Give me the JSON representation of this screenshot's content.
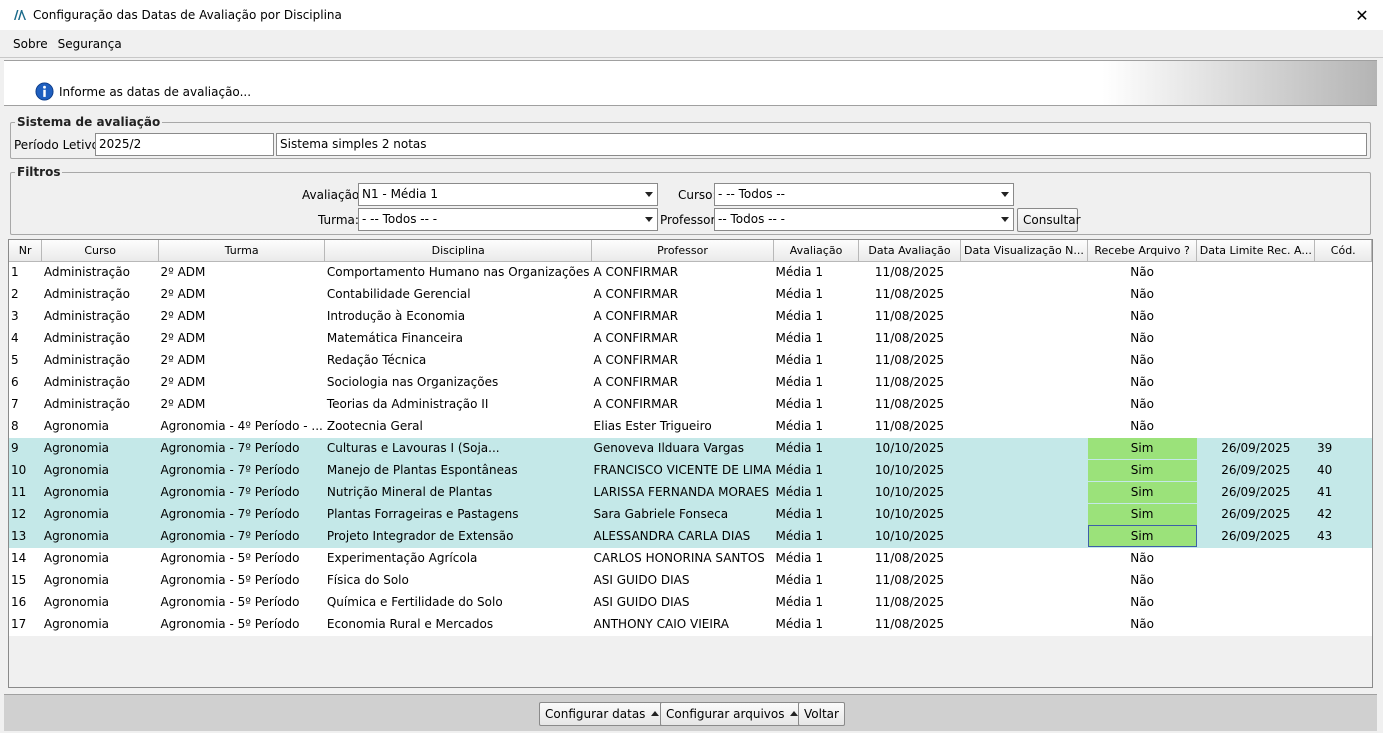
{
  "window": {
    "title": "Configuração das Datas de Avaliação por Disciplina",
    "close_label": "✕"
  },
  "menu": [
    {
      "label": "Sobre"
    },
    {
      "label": "Segurança"
    }
  ],
  "info": {
    "text": "Informe as datas de avaliação..."
  },
  "sistema": {
    "legend": "Sistema de avaliação",
    "periodo_label": "Período Letivo:",
    "periodo_value": "2025/2",
    "sistema_value": "Sistema simples 2 notas"
  },
  "filtros": {
    "legend": "Filtros",
    "avaliacao_label": "Avaliação:",
    "avaliacao_value": "N1 - Média 1",
    "curso_label": "Curso:",
    "curso_value": "- -- Todos --",
    "turma_label": "Turma:",
    "turma_value": "- -- Todos -- -",
    "professor_label": "Professor:",
    "professor_value": "-- Todos -- -",
    "consultar_label": "Consultar"
  },
  "table": {
    "headers": [
      "Nr",
      "Curso",
      "Turma",
      "Disciplina",
      "Professor",
      "Avaliação",
      "Data Avaliação",
      "Data Visualização N...",
      "Recebe Arquivo ?",
      "Data Limite Rec. A...",
      "Cód."
    ],
    "rows": [
      [
        "1",
        "Administração",
        "2º ADM",
        "Comportamento Humano nas Organizações",
        "A CONFIRMAR",
        "Média 1",
        "11/08/2025",
        "",
        "Não",
        "",
        ""
      ],
      [
        "2",
        "Administração",
        "2º ADM",
        "Contabilidade Gerencial",
        "A CONFIRMAR",
        "Média 1",
        "11/08/2025",
        "",
        "Não",
        "",
        ""
      ],
      [
        "3",
        "Administração",
        "2º ADM",
        "Introdução à Economia",
        "A CONFIRMAR",
        "Média 1",
        "11/08/2025",
        "",
        "Não",
        "",
        ""
      ],
      [
        "4",
        "Administração",
        "2º ADM",
        "Matemática Financeira",
        "A CONFIRMAR",
        "Média 1",
        "11/08/2025",
        "",
        "Não",
        "",
        ""
      ],
      [
        "5",
        "Administração",
        "2º ADM",
        "Redação Técnica",
        "A CONFIRMAR",
        "Média 1",
        "11/08/2025",
        "",
        "Não",
        "",
        ""
      ],
      [
        "6",
        "Administração",
        "2º ADM",
        "Sociologia nas Organizações",
        "A CONFIRMAR",
        "Média 1",
        "11/08/2025",
        "",
        "Não",
        "",
        ""
      ],
      [
        "7",
        "Administração",
        "2º ADM",
        "Teorias da Administração II",
        "A CONFIRMAR",
        "Média 1",
        "11/08/2025",
        "",
        "Não",
        "",
        ""
      ],
      [
        "8",
        "Agronomia",
        "Agronomia - 4º Período - ...",
        "Zootecnia Geral",
        "Elias Ester Trigueiro",
        "Média 1",
        "11/08/2025",
        "",
        "Não",
        "",
        ""
      ],
      [
        "9",
        "Agronomia",
        "Agronomia - 7º Período",
        "Culturas e Lavouras I (Soja...",
        "Genoveva Ilduara Vargas",
        "Média 1",
        "10/10/2025",
        "",
        "Sim",
        "26/09/2025",
        "39"
      ],
      [
        "10",
        "Agronomia",
        "Agronomia - 7º Período",
        "Manejo de Plantas Espontâneas",
        "FRANCISCO VICENTE DE LIMA",
        "Média 1",
        "10/10/2025",
        "",
        "Sim",
        "26/09/2025",
        "40"
      ],
      [
        "11",
        "Agronomia",
        "Agronomia - 7º Período",
        "Nutrição Mineral de Plantas",
        "LARISSA FERNANDA MORAES",
        "Média 1",
        "10/10/2025",
        "",
        "Sim",
        "26/09/2025",
        "41"
      ],
      [
        "12",
        "Agronomia",
        "Agronomia - 7º Período",
        "Plantas Forrageiras e Pastagens",
        "Sara Gabriele Fonseca",
        "Média 1",
        "10/10/2025",
        "",
        "Sim",
        "26/09/2025",
        "42"
      ],
      [
        "13",
        "Agronomia",
        "Agronomia - 7º Período",
        "Projeto Integrador de Extensão",
        "ALESSANDRA CARLA DIAS",
        "Média 1",
        "10/10/2025",
        "",
        "Sim",
        "26/09/2025",
        "43"
      ],
      [
        "14",
        "Agronomia",
        "Agronomia - 5º Período",
        "Experimentação Agrícola",
        "CARLOS HONORINA SANTOS",
        "Média 1",
        "11/08/2025",
        "",
        "Não",
        "",
        ""
      ],
      [
        "15",
        "Agronomia",
        "Agronomia - 5º Período",
        "Física do Solo",
        "ASI GUIDO DIAS",
        "Média 1",
        "11/08/2025",
        "",
        "Não",
        "",
        ""
      ],
      [
        "16",
        "Agronomia",
        "Agronomia - 5º Período",
        "Química e Fertilidade do Solo",
        "ASI GUIDO DIAS",
        "Média 1",
        "11/08/2025",
        "",
        "Não",
        "",
        ""
      ],
      [
        "17",
        "Agronomia",
        "Agronomia - 5º Período",
        "Economia Rural e Mercados",
        "ANTHONY CAIO VIEIRA",
        "Média 1",
        "11/08/2025",
        "",
        "Não",
        "",
        ""
      ]
    ]
  },
  "footer": {
    "configurar_datas": "Configurar datas",
    "configurar_arquivos": "Configurar arquivos",
    "voltar": "Voltar"
  },
  "colors": {
    "highlight_row": "#c4e8e8",
    "sim_cell": "#9be27a",
    "info_icon": "#1f5fbf"
  }
}
